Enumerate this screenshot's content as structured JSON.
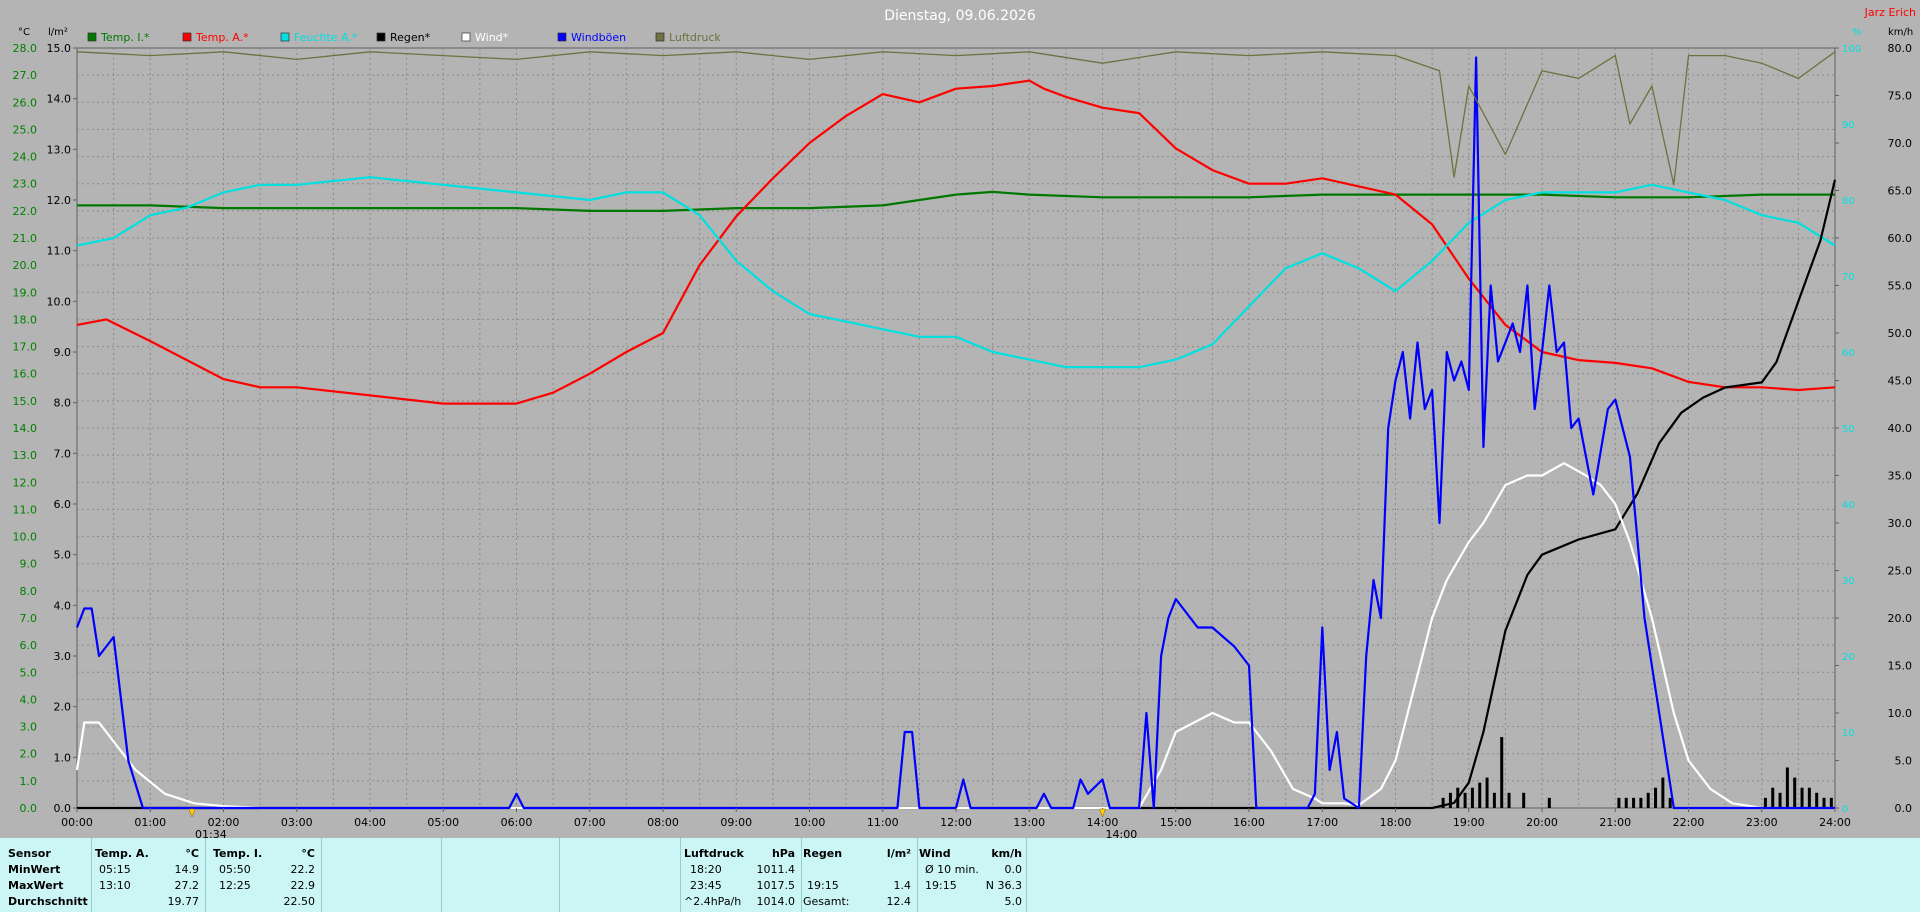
{
  "title": "Dienstag, 09.06.2026",
  "station_name": "Jarz Erich",
  "units": {
    "left_outer": "°C",
    "left_inner": "l/m²",
    "right_outer": "km/h",
    "right_inner": "%"
  },
  "legend": [
    {
      "label": "Temp. I.*",
      "color": "#007800"
    },
    {
      "label": "Temp. A.*",
      "color": "#ff0000"
    },
    {
      "label": "Feuchte A.*",
      "color": "#00e0e0"
    },
    {
      "label": "Regen*",
      "color": "#000000"
    },
    {
      "label": "Wind*",
      "color": "#ffffff"
    },
    {
      "label": "Windböen",
      "color": "#0000ff"
    },
    {
      "label": "Luftdruck",
      "color": "#707040"
    }
  ],
  "markers": [
    {
      "label": "01:34",
      "time": 1.57
    },
    {
      "label": "14:00",
      "time": 14.0
    }
  ],
  "chart_data": {
    "type": "line",
    "x_unit": "hours",
    "x_ticks": [
      "00:00",
      "01:00",
      "02:00",
      "03:00",
      "04:00",
      "05:00",
      "06:00",
      "07:00",
      "08:00",
      "09:00",
      "10:00",
      "11:00",
      "12:00",
      "13:00",
      "14:00",
      "15:00",
      "16:00",
      "17:00",
      "18:00",
      "19:00",
      "20:00",
      "21:00",
      "22:00",
      "23:00",
      "24:00"
    ],
    "xlim": [
      0,
      24
    ],
    "axes": {
      "temp": {
        "ylim": [
          0,
          28
        ],
        "ticks": [
          "0.0",
          "1.0",
          "2.0",
          "3.0",
          "4.0",
          "5.0",
          "6.0",
          "7.0",
          "8.0",
          "9.0",
          "10.0",
          "11.0",
          "12.0",
          "13.0",
          "14.0",
          "15.0",
          "16.0",
          "17.0",
          "18.0",
          "19.0",
          "20.0",
          "21.0",
          "22.0",
          "23.0",
          "24.0",
          "25.0",
          "26.0",
          "27.0",
          "28.0"
        ]
      },
      "rain": {
        "ylim": [
          0,
          15
        ],
        "ticks": [
          "0.0",
          "1.0",
          "2.0",
          "3.0",
          "4.0",
          "5.0",
          "6.0",
          "7.0",
          "8.0",
          "9.0",
          "10.0",
          "11.0",
          "12.0",
          "13.0",
          "14.0",
          "15.0"
        ]
      },
      "humidity": {
        "ylim": [
          0,
          100
        ],
        "ticks": [
          "0",
          "10",
          "20",
          "30",
          "40",
          "50",
          "60",
          "70",
          "80",
          "90",
          "100"
        ]
      },
      "wind": {
        "ylim": [
          0,
          80
        ],
        "ticks": [
          "0.0",
          "5.0",
          "10.0",
          "15.0",
          "20.0",
          "25.0",
          "30.0",
          "35.0",
          "40.0",
          "45.0",
          "50.0",
          "55.0",
          "60.0",
          "65.0",
          "70.0",
          "75.0",
          "80.0"
        ]
      }
    },
    "grid": true,
    "series": [
      {
        "name": "Temp. I.*",
        "axis": "temp",
        "color": "#007800",
        "x": [
          0,
          1,
          2,
          3,
          4,
          5,
          6,
          7,
          8,
          9,
          10,
          11,
          11.5,
          12,
          12.5,
          13,
          14,
          15,
          16,
          17,
          18,
          19,
          20,
          21,
          22,
          23,
          24
        ],
        "y": [
          22.2,
          22.2,
          22.1,
          22.1,
          22.1,
          22.1,
          22.1,
          22.0,
          22.0,
          22.1,
          22.1,
          22.2,
          22.4,
          22.6,
          22.7,
          22.6,
          22.5,
          22.5,
          22.5,
          22.6,
          22.6,
          22.6,
          22.6,
          22.5,
          22.5,
          22.6,
          22.6
        ]
      },
      {
        "name": "Temp. A.*",
        "axis": "temp",
        "color": "#ff0000",
        "x": [
          0,
          0.4,
          1,
          1.5,
          2,
          2.5,
          3,
          4,
          5,
          6,
          6.5,
          7,
          7.5,
          8,
          8.5,
          9,
          9.5,
          10,
          10.5,
          11,
          11.5,
          12,
          12.5,
          13,
          13.2,
          13.5,
          14,
          14.5,
          15,
          15.5,
          16,
          16.5,
          17,
          17.5,
          18,
          18.5,
          19,
          19.5,
          20,
          20.5,
          21,
          21.5,
          22,
          22.5,
          23,
          23.5,
          24
        ],
        "y": [
          17.8,
          18.0,
          17.2,
          16.5,
          15.8,
          15.5,
          15.5,
          15.2,
          14.9,
          14.9,
          15.3,
          16.0,
          16.8,
          17.5,
          20.0,
          21.8,
          23.2,
          24.5,
          25.5,
          26.3,
          26.0,
          26.5,
          26.6,
          26.8,
          26.5,
          26.2,
          25.8,
          25.6,
          24.3,
          23.5,
          23.0,
          23.0,
          23.2,
          22.9,
          22.6,
          21.5,
          19.5,
          17.8,
          16.8,
          16.5,
          16.4,
          16.2,
          15.7,
          15.5,
          15.5,
          15.4,
          15.5
        ]
      },
      {
        "name": "Feuchte A.*",
        "axis": "humidity",
        "color": "#00e0e0",
        "x": [
          0,
          0.5,
          1,
          1.5,
          2,
          2.5,
          3,
          4,
          5,
          6,
          7,
          7.5,
          8,
          8.5,
          9,
          9.5,
          10,
          10.5,
          11,
          11.5,
          12,
          12.5,
          13,
          13.5,
          14,
          14.5,
          15,
          15.5,
          16,
          16.5,
          17,
          17.5,
          18,
          18.5,
          19,
          19.5,
          20,
          20.5,
          21,
          21.5,
          22,
          22.5,
          23,
          23.5,
          24
        ],
        "y": [
          74,
          75,
          78,
          79,
          81,
          82,
          82,
          83,
          82,
          81,
          80,
          81,
          81,
          78,
          72,
          68,
          65,
          64,
          63,
          62,
          62,
          60,
          59,
          58,
          58,
          58,
          59,
          61,
          66,
          71,
          73,
          71,
          68,
          72,
          77,
          80,
          81,
          81,
          81,
          82,
          81,
          80,
          78,
          77,
          74
        ]
      },
      {
        "name": "Regen*",
        "axis": "rain",
        "color": "#000000",
        "x": [
          0,
          18.5,
          18.8,
          19.0,
          19.2,
          19.5,
          19.8,
          20.0,
          20.5,
          21.0,
          21.3,
          21.6,
          21.9,
          22.2,
          22.5,
          23.0,
          23.2,
          23.5,
          23.8,
          24
        ],
        "y": [
          0,
          0,
          0.1,
          0.5,
          1.5,
          3.5,
          4.6,
          5.0,
          5.3,
          5.5,
          6.2,
          7.2,
          7.8,
          8.1,
          8.3,
          8.4,
          8.8,
          10.0,
          11.2,
          12.4
        ]
      },
      {
        "name": "Wind*",
        "axis": "wind",
        "color": "#ffffff",
        "x": [
          0,
          0.1,
          0.3,
          0.5,
          0.8,
          1.2,
          1.6,
          2.0,
          2.5,
          3,
          14.5,
          14.8,
          15.0,
          15.5,
          15.8,
          16.0,
          16.3,
          16.6,
          16.9,
          17.0,
          17.3,
          17.5,
          17.8,
          18.0,
          18.3,
          18.5,
          18.7,
          19.0,
          19.2,
          19.5,
          19.8,
          20.0,
          20.3,
          20.6,
          20.8,
          21.0,
          21.2,
          21.5,
          21.8,
          22.0,
          22.3,
          22.6,
          23.0
        ],
        "y": [
          4,
          9,
          9,
          7,
          4,
          1.5,
          0.5,
          0.2,
          0,
          0,
          0,
          4,
          8,
          10,
          9,
          9,
          6,
          2,
          1,
          0.5,
          0.5,
          0.3,
          2,
          5,
          14,
          20,
          24,
          28,
          30,
          34,
          35,
          35,
          36.3,
          35,
          34,
          32,
          28,
          20,
          10,
          5,
          2,
          0.5,
          0
        ]
      },
      {
        "name": "Windböen",
        "axis": "wind",
        "color": "#0000ff",
        "x": [
          0,
          0.1,
          0.2,
          0.3,
          0.5,
          0.7,
          0.9,
          1.0,
          5.9,
          6.0,
          6.1,
          11.2,
          11.3,
          11.4,
          11.5,
          12.0,
          12.1,
          12.2,
          13.1,
          13.2,
          13.3,
          13.6,
          13.7,
          13.8,
          14.0,
          14.1,
          14.5,
          14.6,
          14.7,
          14.8,
          14.9,
          15.0,
          15.1,
          15.3,
          15.5,
          15.8,
          16.0,
          16.1,
          16.5,
          16.8,
          16.9,
          17.0,
          17.1,
          17.2,
          17.3,
          17.5,
          17.6,
          17.7,
          17.8,
          17.9,
          18.0,
          18.1,
          18.2,
          18.3,
          18.4,
          18.5,
          18.6,
          18.7,
          18.8,
          18.9,
          19.0,
          19.1,
          19.2,
          19.3,
          19.4,
          19.5,
          19.6,
          19.7,
          19.8,
          19.9,
          20.0,
          20.1,
          20.2,
          20.3,
          20.4,
          20.5,
          20.7,
          20.9,
          21.0,
          21.2,
          21.4,
          21.6,
          21.8,
          22.0,
          24
        ],
        "y": [
          19,
          21,
          21,
          16,
          18,
          5,
          0,
          0,
          0,
          1.5,
          0,
          0,
          8,
          8,
          0,
          0,
          3,
          0,
          0,
          1.5,
          0,
          0,
          3,
          1.5,
          3,
          0,
          0,
          10,
          0,
          16,
          20,
          22,
          21,
          19,
          19,
          17,
          15,
          0,
          0,
          0,
          1.5,
          19,
          4,
          8,
          1,
          0,
          16,
          24,
          20,
          40,
          45,
          48,
          41,
          49,
          42,
          44,
          30,
          48,
          45,
          47,
          44,
          79,
          38,
          55,
          47,
          49,
          51,
          48,
          55,
          42,
          48,
          55,
          48,
          49,
          40,
          41,
          33,
          42,
          43,
          37,
          20,
          10,
          0,
          0,
          0
        ]
      },
      {
        "name": "Luftdruck",
        "axis": "humidity",
        "color": "#707040",
        "x": [
          0,
          1,
          2,
          3,
          4,
          5,
          6,
          7,
          8,
          9,
          10,
          11,
          12,
          13,
          14,
          15,
          16,
          17,
          18,
          18.6,
          18.8,
          19.0,
          19.5,
          20.0,
          20.5,
          21.0,
          21.2,
          21.5,
          21.8,
          22.0,
          22.5,
          23.0,
          23.5,
          24
        ],
        "y": [
          99.5,
          99,
          99.5,
          98.5,
          99.5,
          99,
          98.5,
          99.5,
          99,
          99.5,
          98.5,
          99.5,
          99,
          99.5,
          98,
          99.5,
          99,
          99.5,
          99,
          97,
          83,
          95,
          86,
          97,
          96,
          99,
          90,
          95,
          82,
          99,
          99,
          98,
          96,
          99.5
        ]
      }
    ],
    "rain_bars": {
      "axis": "rain",
      "color": "#000000",
      "x": [
        18.65,
        18.75,
        18.85,
        18.95,
        19.05,
        19.15,
        19.25,
        19.35,
        19.45,
        19.55,
        19.75,
        20.1,
        21.05,
        21.15,
        21.25,
        21.35,
        21.45,
        21.55,
        21.65,
        21.75,
        23.05,
        23.15,
        23.25,
        23.35,
        23.45,
        23.55,
        23.65,
        23.75,
        23.85,
        23.95
      ],
      "y": [
        0.2,
        0.3,
        0.4,
        0.3,
        0.4,
        0.5,
        0.6,
        0.3,
        1.4,
        0.3,
        0.3,
        0.2,
        0.2,
        0.2,
        0.2,
        0.2,
        0.3,
        0.4,
        0.6,
        0.2,
        0.2,
        0.4,
        0.3,
        0.8,
        0.6,
        0.4,
        0.4,
        0.3,
        0.2,
        0.2
      ]
    }
  },
  "summary": {
    "row_labels": [
      "Sensor",
      "MinWert",
      "MaxWert",
      "Durchschnitt"
    ],
    "temp_a": {
      "header": "Temp. A.",
      "unit": "°C",
      "min_time": "05:15",
      "min": "14.9",
      "max_time": "13:10",
      "max": "27.2",
      "avg": "19.77"
    },
    "temp_i": {
      "header": "Temp. I.",
      "unit": "°C",
      "min_time": "05:50",
      "min": "22.2",
      "max_time": "12:25",
      "max": "22.9",
      "avg": "22.50"
    },
    "pressure": {
      "header": "Luftdruck",
      "unit": "hPa",
      "min_time": "18:20",
      "min": "1011.4",
      "max_time": "23:45",
      "max": "1017.5",
      "avg_label": "^2.4hPa/h",
      "avg": "1014.0"
    },
    "rain": {
      "header": "Regen",
      "unit": "l/m²",
      "max_time": "19:15",
      "max": "1.4",
      "total_label": "Gesamt:",
      "total": "12.4"
    },
    "wind": {
      "header": "Wind",
      "unit": "km/h",
      "avg10_label": "Ø 10 min.",
      "avg10": "0.0",
      "max_time": "19:15",
      "max": "N 36.3",
      "avg": "5.0"
    }
  }
}
